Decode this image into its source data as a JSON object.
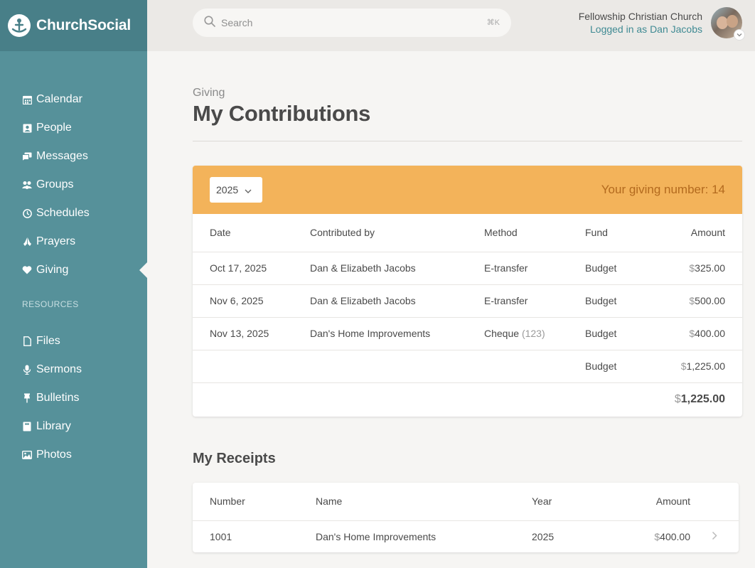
{
  "app": {
    "name": "ChurchSocial"
  },
  "sidebar": {
    "items": [
      {
        "label": "Calendar",
        "icon": "calendar-icon"
      },
      {
        "label": "People",
        "icon": "person-card-icon"
      },
      {
        "label": "Messages",
        "icon": "messages-icon"
      },
      {
        "label": "Groups",
        "icon": "groups-icon"
      },
      {
        "label": "Schedules",
        "icon": "clock-icon"
      },
      {
        "label": "Prayers",
        "icon": "praying-hands-icon"
      },
      {
        "label": "Giving",
        "icon": "heart-icon",
        "active": true
      }
    ],
    "resources_heading": "RESOURCES",
    "resources": [
      {
        "label": "Files",
        "icon": "file-icon"
      },
      {
        "label": "Sermons",
        "icon": "microphone-icon"
      },
      {
        "label": "Bulletins",
        "icon": "pin-icon"
      },
      {
        "label": "Library",
        "icon": "book-icon"
      },
      {
        "label": "Photos",
        "icon": "image-icon"
      }
    ]
  },
  "header": {
    "search_placeholder": "Search",
    "search_shortcut": "⌘K",
    "church_name": "Fellowship Christian Church",
    "logged_in_text": "Logged in as Dan Jacobs"
  },
  "page": {
    "breadcrumb": "Giving",
    "title": "My Contributions"
  },
  "contributions": {
    "year": "2025",
    "giving_number_text": "Your giving number: 14",
    "columns": {
      "date": "Date",
      "contributed_by": "Contributed by",
      "method": "Method",
      "fund": "Fund",
      "amount": "Amount"
    },
    "currency_symbol": "$",
    "rows": [
      {
        "date": "Oct 17, 2025",
        "contributed_by": "Dan & Elizabeth Jacobs",
        "method": "E-transfer",
        "method_detail": "",
        "fund": "Budget",
        "amount": "325.00"
      },
      {
        "date": "Nov 6, 2025",
        "contributed_by": "Dan & Elizabeth Jacobs",
        "method": "E-transfer",
        "method_detail": "",
        "fund": "Budget",
        "amount": "500.00"
      },
      {
        "date": "Nov 13, 2025",
        "contributed_by": "Dan's Home Improvements",
        "method": "Cheque",
        "method_detail": "(123)",
        "fund": "Budget",
        "amount": "400.00"
      }
    ],
    "fund_subtotal": {
      "fund": "Budget",
      "amount": "1,225.00"
    },
    "grand_total": "1,225.00"
  },
  "receipts": {
    "title": "My Receipts",
    "columns": {
      "number": "Number",
      "name": "Name",
      "year": "Year",
      "amount": "Amount"
    },
    "rows": [
      {
        "number": "1001",
        "name": "Dan's Home Improvements",
        "year": "2025",
        "amount": "400.00"
      }
    ]
  },
  "colors": {
    "sidebar": "#56919a",
    "logo_bar": "#487f88",
    "accent_orange": "#f3b35a",
    "link_teal": "#3f8a93"
  }
}
